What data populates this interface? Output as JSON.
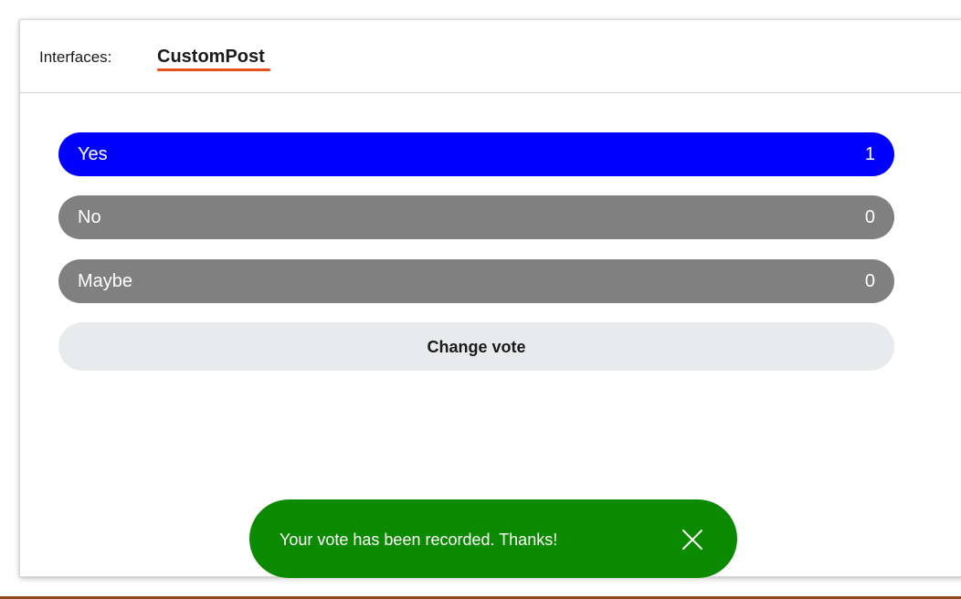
{
  "header": {
    "interfaces_label": "Interfaces:",
    "active_tab": "CustomPost"
  },
  "poll": {
    "options": [
      {
        "label": "Yes",
        "count": "1",
        "selected": true,
        "color": "#0000ff"
      },
      {
        "label": "No",
        "count": "0",
        "selected": false,
        "color": "#808080"
      },
      {
        "label": "Maybe",
        "count": "0",
        "selected": false,
        "color": "#808080"
      }
    ],
    "change_vote_label": "Change vote"
  },
  "toast": {
    "message": "Your vote has been recorded. Thanks!",
    "color": "#0b8a00",
    "close_icon": "close-icon"
  },
  "colors": {
    "tab_underline": "#e8501e",
    "change_vote_bg": "#e8ebee"
  }
}
